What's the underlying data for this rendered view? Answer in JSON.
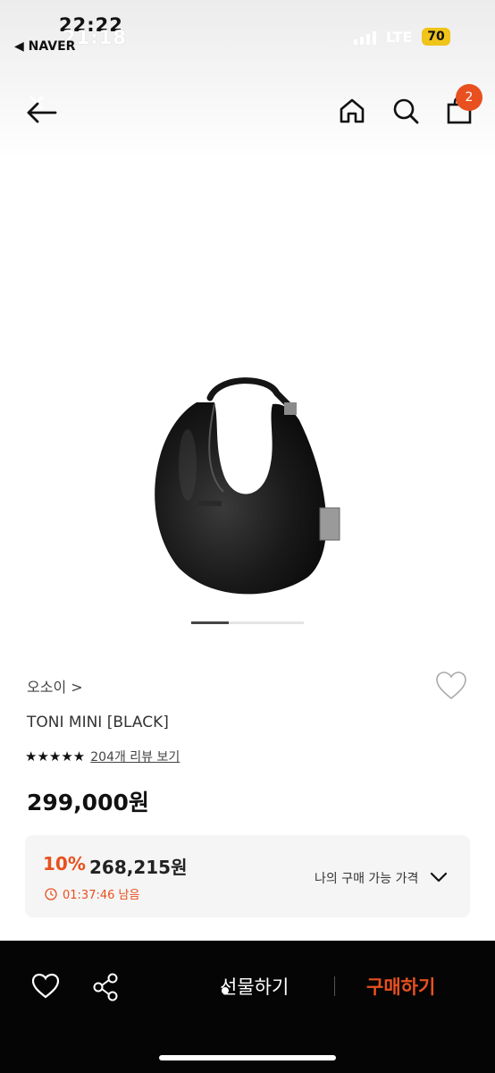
{
  "status_bar": {
    "time_ghost": "22:22",
    "time": "21:18",
    "back_app": "◀ NAVER",
    "network": "LTE",
    "battery": "70"
  },
  "header": {
    "back_icon": "back-arrow-icon",
    "home_icon": "home-icon",
    "search_icon": "search-icon",
    "cart_icon": "shopping-bag-icon",
    "cart_badge": "2"
  },
  "product": {
    "brand": "오소이 >",
    "name": "TONI MINI [BLACK]",
    "stars": "★★★★★",
    "rating": 5,
    "review_link": "204개 리뷰 보기",
    "price": "299,000원",
    "image_index": 1,
    "image_count": 3
  },
  "discount": {
    "rate": "10%",
    "price": "268,215원",
    "timer": "01:37:46 남음",
    "my_price_label": "나의 구매 가능 가격"
  },
  "bottom_bar": {
    "heart_icon": "heart-icon",
    "share_icon": "share-icon",
    "gift_label": "선물하기",
    "buy_label": "구매하기"
  },
  "colors": {
    "accent": "#e8501f",
    "battery": "#f0c419",
    "bottom_bar": "#050505"
  }
}
